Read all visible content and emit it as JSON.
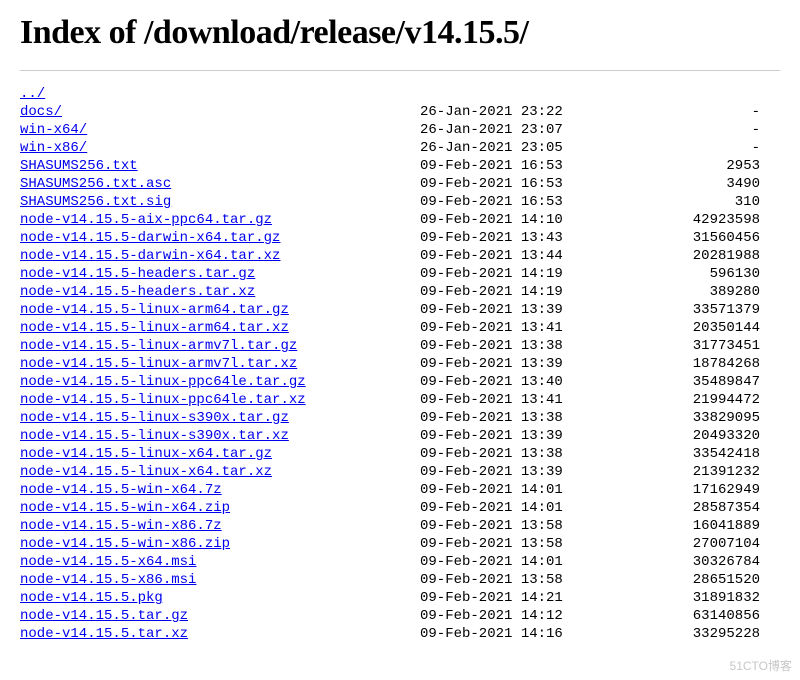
{
  "title": "Index of /download/release/v14.15.5/",
  "parent_label": "../",
  "watermark": "51CTO博客",
  "entries": [
    {
      "name": "docs/",
      "date": "26-Jan-2021 23:22",
      "size": "-"
    },
    {
      "name": "win-x64/",
      "date": "26-Jan-2021 23:07",
      "size": "-"
    },
    {
      "name": "win-x86/",
      "date": "26-Jan-2021 23:05",
      "size": "-"
    },
    {
      "name": "SHASUMS256.txt",
      "date": "09-Feb-2021 16:53",
      "size": "2953"
    },
    {
      "name": "SHASUMS256.txt.asc",
      "date": "09-Feb-2021 16:53",
      "size": "3490"
    },
    {
      "name": "SHASUMS256.txt.sig",
      "date": "09-Feb-2021 16:53",
      "size": "310"
    },
    {
      "name": "node-v14.15.5-aix-ppc64.tar.gz",
      "date": "09-Feb-2021 14:10",
      "size": "42923598"
    },
    {
      "name": "node-v14.15.5-darwin-x64.tar.gz",
      "date": "09-Feb-2021 13:43",
      "size": "31560456"
    },
    {
      "name": "node-v14.15.5-darwin-x64.tar.xz",
      "date": "09-Feb-2021 13:44",
      "size": "20281988"
    },
    {
      "name": "node-v14.15.5-headers.tar.gz",
      "date": "09-Feb-2021 14:19",
      "size": "596130"
    },
    {
      "name": "node-v14.15.5-headers.tar.xz",
      "date": "09-Feb-2021 14:19",
      "size": "389280"
    },
    {
      "name": "node-v14.15.5-linux-arm64.tar.gz",
      "date": "09-Feb-2021 13:39",
      "size": "33571379"
    },
    {
      "name": "node-v14.15.5-linux-arm64.tar.xz",
      "date": "09-Feb-2021 13:41",
      "size": "20350144"
    },
    {
      "name": "node-v14.15.5-linux-armv7l.tar.gz",
      "date": "09-Feb-2021 13:38",
      "size": "31773451"
    },
    {
      "name": "node-v14.15.5-linux-armv7l.tar.xz",
      "date": "09-Feb-2021 13:39",
      "size": "18784268"
    },
    {
      "name": "node-v14.15.5-linux-ppc64le.tar.gz",
      "date": "09-Feb-2021 13:40",
      "size": "35489847"
    },
    {
      "name": "node-v14.15.5-linux-ppc64le.tar.xz",
      "date": "09-Feb-2021 13:41",
      "size": "21994472"
    },
    {
      "name": "node-v14.15.5-linux-s390x.tar.gz",
      "date": "09-Feb-2021 13:38",
      "size": "33829095"
    },
    {
      "name": "node-v14.15.5-linux-s390x.tar.xz",
      "date": "09-Feb-2021 13:39",
      "size": "20493320"
    },
    {
      "name": "node-v14.15.5-linux-x64.tar.gz",
      "date": "09-Feb-2021 13:38",
      "size": "33542418"
    },
    {
      "name": "node-v14.15.5-linux-x64.tar.xz",
      "date": "09-Feb-2021 13:39",
      "size": "21391232"
    },
    {
      "name": "node-v14.15.5-win-x64.7z",
      "date": "09-Feb-2021 14:01",
      "size": "17162949"
    },
    {
      "name": "node-v14.15.5-win-x64.zip",
      "date": "09-Feb-2021 14:01",
      "size": "28587354"
    },
    {
      "name": "node-v14.15.5-win-x86.7z",
      "date": "09-Feb-2021 13:58",
      "size": "16041889"
    },
    {
      "name": "node-v14.15.5-win-x86.zip",
      "date": "09-Feb-2021 13:58",
      "size": "27007104"
    },
    {
      "name": "node-v14.15.5-x64.msi",
      "date": "09-Feb-2021 14:01",
      "size": "30326784"
    },
    {
      "name": "node-v14.15.5-x86.msi",
      "date": "09-Feb-2021 13:58",
      "size": "28651520"
    },
    {
      "name": "node-v14.15.5.pkg",
      "date": "09-Feb-2021 14:21",
      "size": "31891832"
    },
    {
      "name": "node-v14.15.5.tar.gz",
      "date": "09-Feb-2021 14:12",
      "size": "63140856"
    },
    {
      "name": "node-v14.15.5.tar.xz",
      "date": "09-Feb-2021 14:16",
      "size": "33295228"
    }
  ]
}
